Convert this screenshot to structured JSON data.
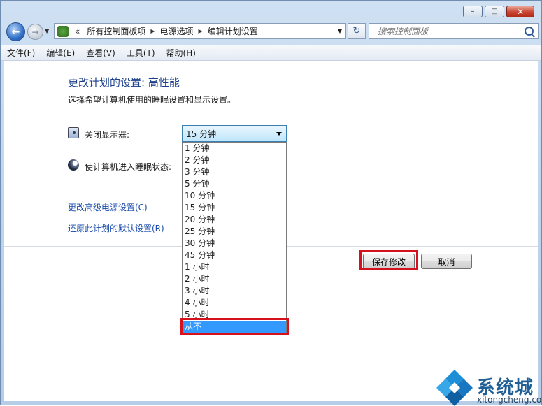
{
  "window": {
    "minimize": "–",
    "maximize": "□",
    "close": "✕"
  },
  "nav": {
    "back_icon": "←",
    "forward_icon": "→",
    "dropdown_icon": "▼"
  },
  "address": {
    "chevron": "«",
    "segments": [
      "所有控制面板项",
      "电源选项",
      "编辑计划设置"
    ],
    "separator": "▶",
    "dropdown_icon": "▼",
    "refresh_icon": "↻"
  },
  "search": {
    "placeholder": "搜索控制面板"
  },
  "menu": [
    "文件(F)",
    "编辑(E)",
    "查看(V)",
    "工具(T)",
    "帮助(H)"
  ],
  "content": {
    "title": "更改计划的设置: 高性能",
    "subtitle": "选择希望计算机使用的睡眠设置和显示设置。",
    "display_label": "关闭显示器:",
    "sleep_label": "使计算机进入睡眠状态:",
    "display_value": "15 分钟",
    "dropdown_options": [
      "1 分钟",
      "2 分钟",
      "3 分钟",
      "5 分钟",
      "10 分钟",
      "15 分钟",
      "20 分钟",
      "25 分钟",
      "30 分钟",
      "45 分钟",
      "1 小时",
      "2 小时",
      "3 小时",
      "4 小时",
      "5 小时",
      "从不"
    ],
    "selected_option": "从不",
    "link_advanced": "更改高级电源设置(C)",
    "link_restore": "还原此计划的默认设置(R)",
    "save_button": "保存修改",
    "cancel_button": "取消"
  },
  "watermark": {
    "brand": "系统城",
    "url": "xitongcheng.com"
  },
  "colors": {
    "highlight_box": "#d4111c",
    "selection": "#3399ff",
    "title_text": "#1b3f8c",
    "link_text": "#1a4cab"
  }
}
